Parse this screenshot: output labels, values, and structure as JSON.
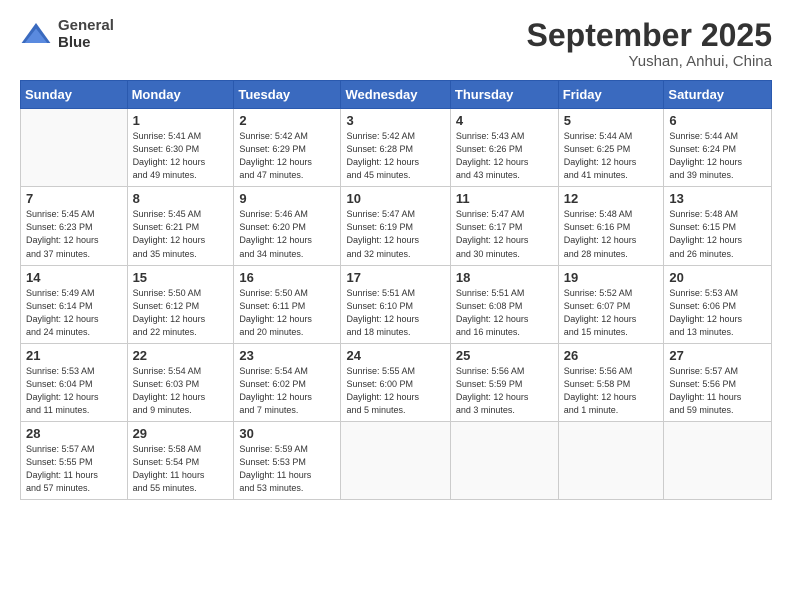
{
  "header": {
    "title": "September 2025",
    "subtitle": "Yushan, Anhui, China",
    "logo_line1": "General",
    "logo_line2": "Blue"
  },
  "weekdays": [
    "Sunday",
    "Monday",
    "Tuesday",
    "Wednesday",
    "Thursday",
    "Friday",
    "Saturday"
  ],
  "weeks": [
    [
      {
        "day": "",
        "info": ""
      },
      {
        "day": "1",
        "info": "Sunrise: 5:41 AM\nSunset: 6:30 PM\nDaylight: 12 hours\nand 49 minutes."
      },
      {
        "day": "2",
        "info": "Sunrise: 5:42 AM\nSunset: 6:29 PM\nDaylight: 12 hours\nand 47 minutes."
      },
      {
        "day": "3",
        "info": "Sunrise: 5:42 AM\nSunset: 6:28 PM\nDaylight: 12 hours\nand 45 minutes."
      },
      {
        "day": "4",
        "info": "Sunrise: 5:43 AM\nSunset: 6:26 PM\nDaylight: 12 hours\nand 43 minutes."
      },
      {
        "day": "5",
        "info": "Sunrise: 5:44 AM\nSunset: 6:25 PM\nDaylight: 12 hours\nand 41 minutes."
      },
      {
        "day": "6",
        "info": "Sunrise: 5:44 AM\nSunset: 6:24 PM\nDaylight: 12 hours\nand 39 minutes."
      }
    ],
    [
      {
        "day": "7",
        "info": "Sunrise: 5:45 AM\nSunset: 6:23 PM\nDaylight: 12 hours\nand 37 minutes."
      },
      {
        "day": "8",
        "info": "Sunrise: 5:45 AM\nSunset: 6:21 PM\nDaylight: 12 hours\nand 35 minutes."
      },
      {
        "day": "9",
        "info": "Sunrise: 5:46 AM\nSunset: 6:20 PM\nDaylight: 12 hours\nand 34 minutes."
      },
      {
        "day": "10",
        "info": "Sunrise: 5:47 AM\nSunset: 6:19 PM\nDaylight: 12 hours\nand 32 minutes."
      },
      {
        "day": "11",
        "info": "Sunrise: 5:47 AM\nSunset: 6:17 PM\nDaylight: 12 hours\nand 30 minutes."
      },
      {
        "day": "12",
        "info": "Sunrise: 5:48 AM\nSunset: 6:16 PM\nDaylight: 12 hours\nand 28 minutes."
      },
      {
        "day": "13",
        "info": "Sunrise: 5:48 AM\nSunset: 6:15 PM\nDaylight: 12 hours\nand 26 minutes."
      }
    ],
    [
      {
        "day": "14",
        "info": "Sunrise: 5:49 AM\nSunset: 6:14 PM\nDaylight: 12 hours\nand 24 minutes."
      },
      {
        "day": "15",
        "info": "Sunrise: 5:50 AM\nSunset: 6:12 PM\nDaylight: 12 hours\nand 22 minutes."
      },
      {
        "day": "16",
        "info": "Sunrise: 5:50 AM\nSunset: 6:11 PM\nDaylight: 12 hours\nand 20 minutes."
      },
      {
        "day": "17",
        "info": "Sunrise: 5:51 AM\nSunset: 6:10 PM\nDaylight: 12 hours\nand 18 minutes."
      },
      {
        "day": "18",
        "info": "Sunrise: 5:51 AM\nSunset: 6:08 PM\nDaylight: 12 hours\nand 16 minutes."
      },
      {
        "day": "19",
        "info": "Sunrise: 5:52 AM\nSunset: 6:07 PM\nDaylight: 12 hours\nand 15 minutes."
      },
      {
        "day": "20",
        "info": "Sunrise: 5:53 AM\nSunset: 6:06 PM\nDaylight: 12 hours\nand 13 minutes."
      }
    ],
    [
      {
        "day": "21",
        "info": "Sunrise: 5:53 AM\nSunset: 6:04 PM\nDaylight: 12 hours\nand 11 minutes."
      },
      {
        "day": "22",
        "info": "Sunrise: 5:54 AM\nSunset: 6:03 PM\nDaylight: 12 hours\nand 9 minutes."
      },
      {
        "day": "23",
        "info": "Sunrise: 5:54 AM\nSunset: 6:02 PM\nDaylight: 12 hours\nand 7 minutes."
      },
      {
        "day": "24",
        "info": "Sunrise: 5:55 AM\nSunset: 6:00 PM\nDaylight: 12 hours\nand 5 minutes."
      },
      {
        "day": "25",
        "info": "Sunrise: 5:56 AM\nSunset: 5:59 PM\nDaylight: 12 hours\nand 3 minutes."
      },
      {
        "day": "26",
        "info": "Sunrise: 5:56 AM\nSunset: 5:58 PM\nDaylight: 12 hours\nand 1 minute."
      },
      {
        "day": "27",
        "info": "Sunrise: 5:57 AM\nSunset: 5:56 PM\nDaylight: 11 hours\nand 59 minutes."
      }
    ],
    [
      {
        "day": "28",
        "info": "Sunrise: 5:57 AM\nSunset: 5:55 PM\nDaylight: 11 hours\nand 57 minutes."
      },
      {
        "day": "29",
        "info": "Sunrise: 5:58 AM\nSunset: 5:54 PM\nDaylight: 11 hours\nand 55 minutes."
      },
      {
        "day": "30",
        "info": "Sunrise: 5:59 AM\nSunset: 5:53 PM\nDaylight: 11 hours\nand 53 minutes."
      },
      {
        "day": "",
        "info": ""
      },
      {
        "day": "",
        "info": ""
      },
      {
        "day": "",
        "info": ""
      },
      {
        "day": "",
        "info": ""
      }
    ]
  ]
}
